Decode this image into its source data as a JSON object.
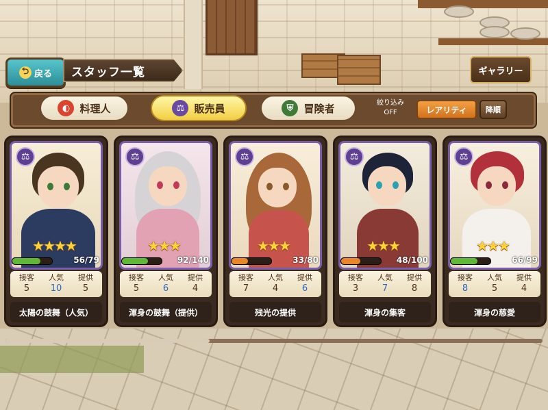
{
  "header": {
    "back_label": "戻る",
    "title": "スタッフ一覧",
    "gallery_label": "ギャラリー"
  },
  "filter": {
    "tabs": [
      {
        "label": "料理人",
        "icon": "chef-icon",
        "active": false
      },
      {
        "label": "販売員",
        "icon": "scales-icon",
        "active": true
      },
      {
        "label": "冒険者",
        "icon": "adventurer-icon",
        "active": false
      }
    ],
    "narrow_label": "絞り込み",
    "narrow_state": "OFF",
    "sort_label": "レアリティ",
    "order_label": "降順"
  },
  "cards": [
    {
      "stars": "★★★★",
      "hp_current": 56,
      "hp_max": 79,
      "hp_text": "56/79",
      "bar_color": "#5fb838",
      "stats": {
        "service": "5",
        "popularity": "10",
        "supply": "5"
      },
      "popularity_highlight": true,
      "skill": "太陽の鼓舞（人気）"
    },
    {
      "stars": "★★★",
      "hp_current": 92,
      "hp_max": 140,
      "hp_text": "92/140",
      "bar_color": "#5fb838",
      "stats": {
        "service": "5",
        "popularity": "6",
        "supply": "4"
      },
      "popularity_highlight": true,
      "skill": "渾身の鼓舞（提供）"
    },
    {
      "stars": "★★★",
      "hp_current": 33,
      "hp_max": 80,
      "hp_text": "33/80",
      "bar_color": "#e8872a",
      "stats": {
        "service": "7",
        "popularity": "4",
        "supply": "6"
      },
      "supply_highlight": true,
      "skill": "残光の提供"
    },
    {
      "stars": "★★★",
      "hp_current": 48,
      "hp_max": 100,
      "hp_text": "48/100",
      "bar_color": "#e8872a",
      "stats": {
        "service": "3",
        "popularity": "7",
        "supply": "8"
      },
      "popularity_highlight": true,
      "skill": "渾身の集客"
    },
    {
      "stars": "★★★",
      "hp_current": 66,
      "hp_max": 99,
      "hp_text": "66/99",
      "bar_color": "#5fb838",
      "stats": {
        "service": "8",
        "popularity": "5",
        "supply": "4"
      },
      "service_highlight": true,
      "skill": "渾身の慈愛"
    }
  ],
  "stat_labels": {
    "service": "接客",
    "popularity": "人気",
    "supply": "提供"
  },
  "scroll": {
    "position_fraction": 0.38
  },
  "colors": {
    "accent": "#f2cf43",
    "frame": "#7a5fa8",
    "teal_button": "#2c8e98"
  }
}
